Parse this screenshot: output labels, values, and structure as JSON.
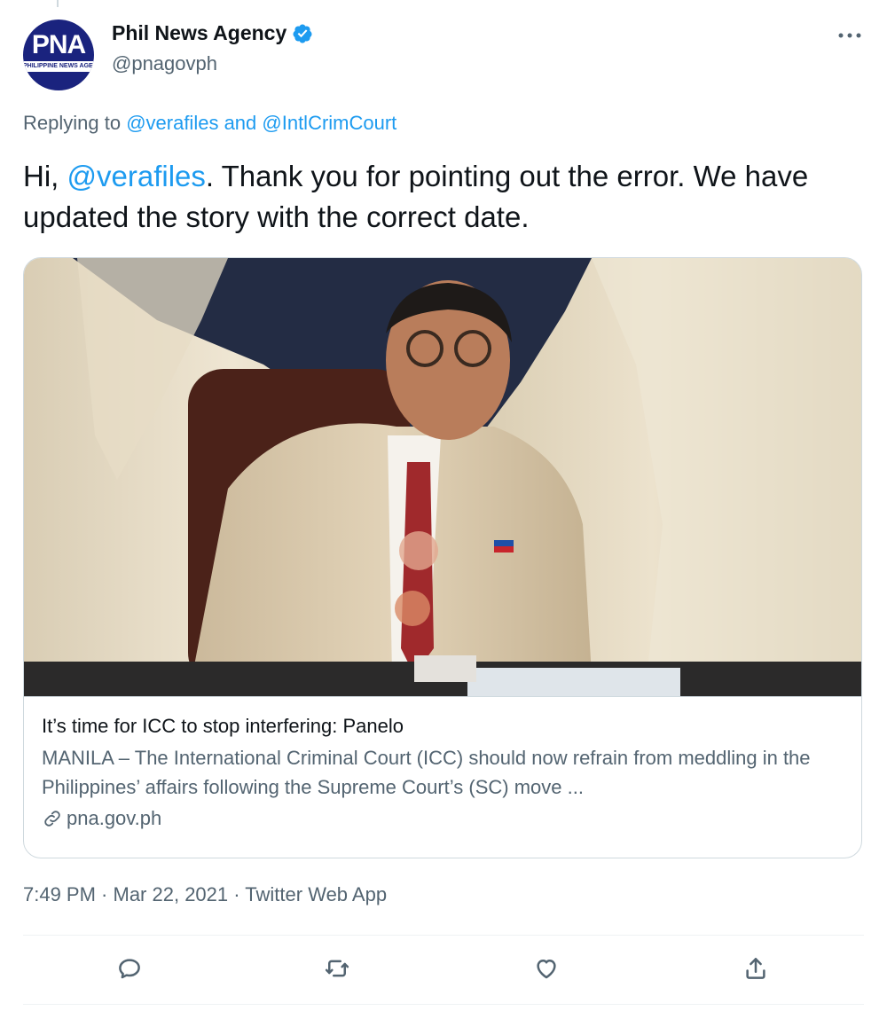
{
  "author": {
    "display_name": "Phil News Agency",
    "handle": "@pnagovph",
    "avatar_text": "PNA",
    "avatar_band_text": "PHILIPPINE NEWS AGENCY",
    "verified": true
  },
  "reply": {
    "prefix": "Replying to ",
    "first_mention": "@verafiles",
    "joiner": " and ",
    "second_mention": "@IntlCrimCourt"
  },
  "tweet": {
    "text_before": "Hi, ",
    "mention": "@verafiles",
    "text_after": ". Thank you for pointing out the error. We have updated the story with the correct date."
  },
  "card": {
    "image_icon": "article-photo",
    "title": "It’s time for ICC to stop interfering: Panelo",
    "description": "MANILA – The International Criminal Court (ICC) should now refrain from meddling in the Philippines’ affairs following the Supreme Court’s (SC) move ...",
    "domain": "pna.gov.ph"
  },
  "meta": {
    "time": "7:49 PM",
    "sep1": " · ",
    "date": "Mar 22, 2021",
    "sep2": " · ",
    "source": "Twitter Web App"
  },
  "actions": [
    {
      "name": "reply",
      "icon": "reply-icon"
    },
    {
      "name": "retweet",
      "icon": "retweet-icon"
    },
    {
      "name": "like",
      "icon": "heart-icon"
    },
    {
      "name": "share",
      "icon": "share-icon"
    }
  ],
  "colors": {
    "link": "#1d9bf0",
    "secondary_text": "#536471",
    "primary_text": "#0f1419",
    "border": "#cfd9de",
    "avatar_bg": "#1a237e"
  }
}
